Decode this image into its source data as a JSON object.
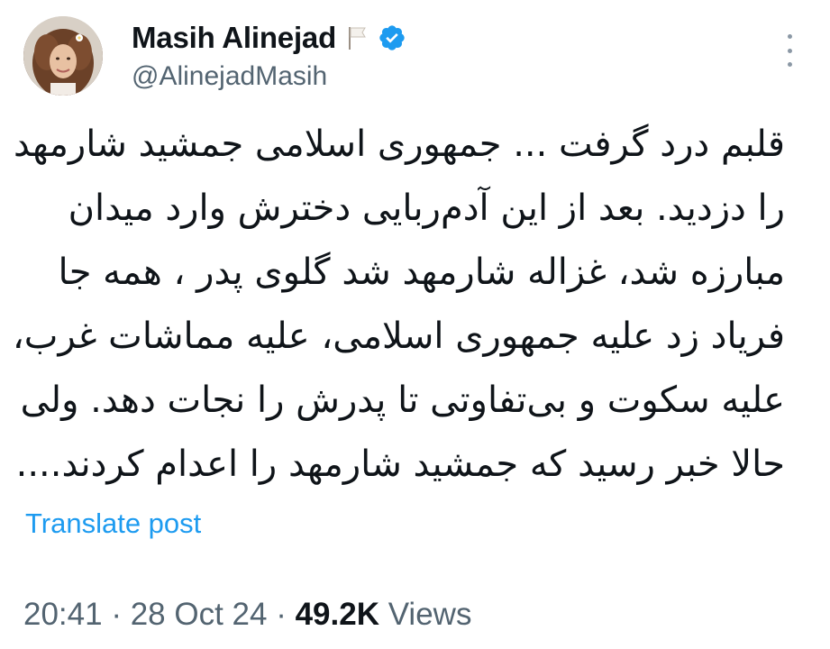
{
  "author": {
    "display_name": "Masih Alinejad",
    "handle": "@AlinejadMasih",
    "flag_icon": "white-flag-icon",
    "verified_icon": "verified-badge-icon",
    "verified_color": "#1d9bf0"
  },
  "more_menu": {
    "icon": "more-vertical-icon"
  },
  "tweet": {
    "lines": [
      "قلبم درد گرفت ... جمهوری اسلامی جمشید شارمهد",
      "را دزدید. بعد از این آدم‌ربایی دخترش وارد میدان",
      "مبارزه شد، غزاله شارمهد شد گلوی پدر ، همه جا",
      "فریاد زد علیه جمهوری اسلامی، علیه مماشات غرب،",
      "علیه سکوت و بی‌تفاوتی تا پدرش را نجات دهد. ولی",
      "حالا خبر رسید که جمشید شارمهد را اعدام کردند...."
    ],
    "translate_label": "Translate post",
    "link_color": "#1d9bf0"
  },
  "meta": {
    "time": "20:41",
    "separator": " · ",
    "date": "28 Oct 24",
    "views_count": "49.2K",
    "views_label": " Views"
  }
}
